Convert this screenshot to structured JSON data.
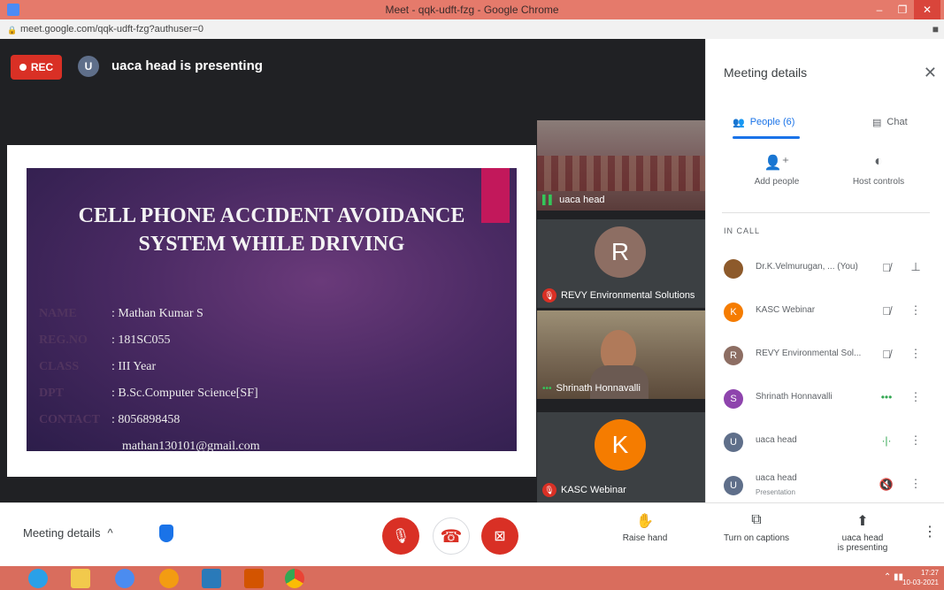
{
  "window": {
    "title": "Meet - qqk-udft-fzg - Google Chrome",
    "url": "meet.google.com/qqk-udft-fzg?authuser=0"
  },
  "stage": {
    "rec_label": "REC",
    "presenter_initial": "U",
    "presenting_text": "uaca head is presenting"
  },
  "slide": {
    "title_line1": "CELL PHONE ACCIDENT AVOIDANCE",
    "title_line2": "SYSTEM WHILE DRIVING",
    "rows": [
      {
        "key": "NAME",
        "value": ": Mathan Kumar S"
      },
      {
        "key": "REG.NO",
        "value": ": 181SC055"
      },
      {
        "key": "CLASS",
        "value": ": III Year"
      },
      {
        "key": "DPT",
        "value": ": B.Sc.Computer Science[SF]"
      },
      {
        "key": "CONTACT",
        "value": ": 8056898458"
      },
      {
        "key": "",
        "value": "mathan130101@gmail.com"
      }
    ]
  },
  "tiles": [
    {
      "name": "uaca head",
      "state": "speaking"
    },
    {
      "name": "REVY Environmental Solutions",
      "initial": "R",
      "state": "muted"
    },
    {
      "name": "Shrinath Honnavalli",
      "state": "dots"
    },
    {
      "name": "KASC Webinar",
      "initial": "K",
      "state": "muted"
    }
  ],
  "panel": {
    "title": "Meeting details",
    "tab_people": "People (6)",
    "tab_chat": "Chat",
    "add_people": "Add people",
    "host_controls": "Host controls",
    "in_call_label": "IN CALL",
    "people": [
      {
        "name": "Dr.K.Velmurugan, ... (You)",
        "initial": "",
        "color": "#8d5a2b",
        "status": "mic-off-icon"
      },
      {
        "name": "KASC Webinar",
        "initial": "K",
        "color": "#f57c00",
        "status": "mic-off-icon"
      },
      {
        "name": "REVY Environmental Sol...",
        "initial": "R",
        "color": "#8d6e63",
        "status": "mic-off-icon"
      },
      {
        "name": "Shrinath Honnavalli",
        "initial": "S",
        "color": "#8e44ad",
        "status": "dots"
      },
      {
        "name": "uaca head",
        "initial": "U",
        "color": "#5f6f8a",
        "status": "speaking"
      },
      {
        "name": "uaca head",
        "sub": "Presentation",
        "initial": "U",
        "color": "#5f6f8a",
        "status": "mic-off-icon"
      }
    ]
  },
  "bottom": {
    "meeting_details": "Meeting details",
    "raise_hand": "Raise hand",
    "captions": "Turn on captions",
    "presenting_line1": "uaca head",
    "presenting_line2": "is presenting"
  },
  "taskbar": {
    "time": "17:27",
    "date": "10-03-2021"
  }
}
